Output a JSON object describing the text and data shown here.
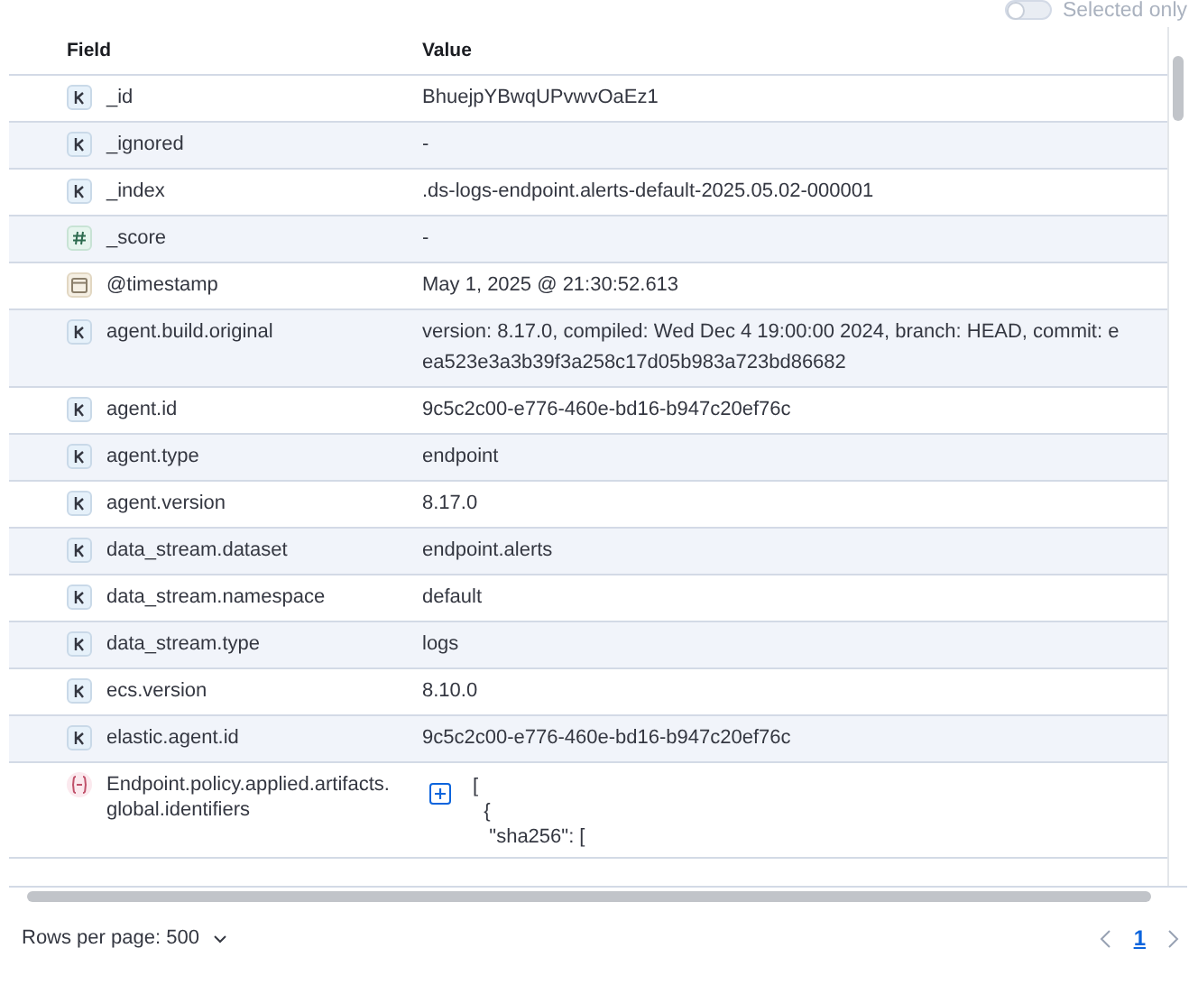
{
  "toolbar": {
    "toggle": {
      "label": "Selected only",
      "on": false
    }
  },
  "table": {
    "columns": [
      "Field",
      "Value"
    ],
    "rows": [
      {
        "kind": "keyword",
        "field": "_id",
        "value": [
          "BhuejpYBwqUPvwvOaEz1"
        ]
      },
      {
        "kind": "keyword",
        "field": "_ignored",
        "value": [
          "-"
        ]
      },
      {
        "kind": "keyword",
        "field": "_index",
        "value": [
          ".ds-logs-endpoint.alerts-default-2025.05.02-000001"
        ]
      },
      {
        "kind": "number",
        "field": "_score",
        "value": [
          "-"
        ]
      },
      {
        "kind": "date",
        "field": "@timestamp",
        "value": [
          "May 1, 2025 @ 21:30:52.613"
        ]
      },
      {
        "kind": "keyword",
        "field": "agent.build.original",
        "value": [
          "version: 8.17.0, compiled: Wed Dec 4 19:00:00 2024, branch: HEAD, commit: e",
          "ea523e3a3b39f3a258c17d05b983a723bd86682"
        ]
      },
      {
        "kind": "keyword",
        "field": "agent.id",
        "value": [
          "9c5c2c00-e776-460e-bd16-b947c20ef76c"
        ]
      },
      {
        "kind": "keyword",
        "field": "agent.type",
        "value": [
          "endpoint"
        ]
      },
      {
        "kind": "keyword",
        "field": "agent.version",
        "value": [
          "8.17.0"
        ]
      },
      {
        "kind": "keyword",
        "field": "data_stream.dataset",
        "value": [
          "endpoint.alerts"
        ]
      },
      {
        "kind": "keyword",
        "field": "data_stream.namespace",
        "value": [
          "default"
        ]
      },
      {
        "kind": "keyword",
        "field": "data_stream.type",
        "value": [
          "logs"
        ]
      },
      {
        "kind": "keyword",
        "field": "ecs.version",
        "value": [
          "8.10.0"
        ]
      },
      {
        "kind": "keyword",
        "field": "elastic.agent.id",
        "value": [
          "9c5c2c00-e776-460e-bd16-b947c20ef76c"
        ]
      },
      {
        "kind": "object",
        "field": "Endpoint.policy.applied.artifacts.global.identifiers",
        "value": [
          "[",
          "  {",
          "   \"sha256\": ["
        ],
        "expandable": true
      }
    ]
  },
  "footer": {
    "rows_per_page": "Rows per page: 500",
    "pages": [
      {
        "label": "1",
        "selected": true
      }
    ]
  }
}
